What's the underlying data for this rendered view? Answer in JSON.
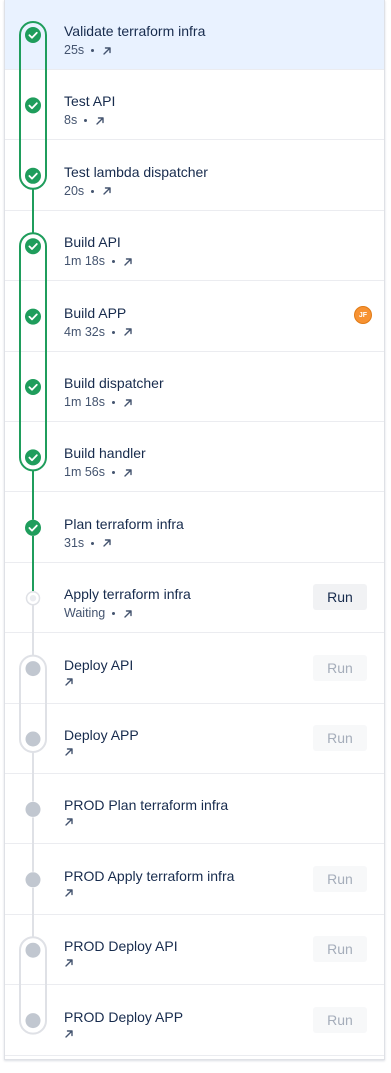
{
  "run_label": "Run",
  "colors": {
    "success": "#1f9d5c",
    "pending": "#c1c7d0",
    "selected_bg": "#e9f2ff",
    "avatar": "#f79232"
  },
  "steps": [
    {
      "name": "Validate terraform infra",
      "duration": "25s",
      "status": "success",
      "selected": true
    },
    {
      "name": "Test API",
      "duration": "8s",
      "status": "success"
    },
    {
      "name": "Test lambda dispatcher",
      "duration": "20s",
      "status": "success"
    },
    {
      "name": "Build API",
      "duration": "1m 18s",
      "status": "success"
    },
    {
      "name": "Build APP",
      "duration": "4m 32s",
      "status": "success",
      "avatar": "JF"
    },
    {
      "name": "Build dispatcher",
      "duration": "1m 18s",
      "status": "success"
    },
    {
      "name": "Build handler",
      "duration": "1m 56s",
      "status": "success"
    },
    {
      "name": "Plan terraform infra",
      "duration": "31s",
      "status": "success"
    },
    {
      "name": "Apply terraform infra",
      "duration": "Waiting",
      "status": "waiting",
      "run": "enabled"
    },
    {
      "name": "Deploy API",
      "duration": "",
      "status": "pending",
      "run": "disabled"
    },
    {
      "name": "Deploy APP",
      "duration": "",
      "status": "pending",
      "run": "disabled"
    },
    {
      "name": "PROD Plan terraform infra",
      "duration": "",
      "status": "pending"
    },
    {
      "name": "PROD Apply terraform infra",
      "duration": "",
      "status": "pending",
      "run": "disabled"
    },
    {
      "name": "PROD Deploy API",
      "duration": "",
      "status": "pending",
      "run": "disabled"
    },
    {
      "name": "PROD Deploy APP",
      "duration": "",
      "status": "pending",
      "run": "disabled"
    }
  ],
  "stages": [
    {
      "from": 0,
      "to": 2,
      "status": "success"
    },
    {
      "from": 3,
      "to": 6,
      "status": "success"
    },
    {
      "from": 9,
      "to": 10,
      "status": "pending"
    },
    {
      "from": 13,
      "to": 14,
      "status": "pending"
    }
  ]
}
